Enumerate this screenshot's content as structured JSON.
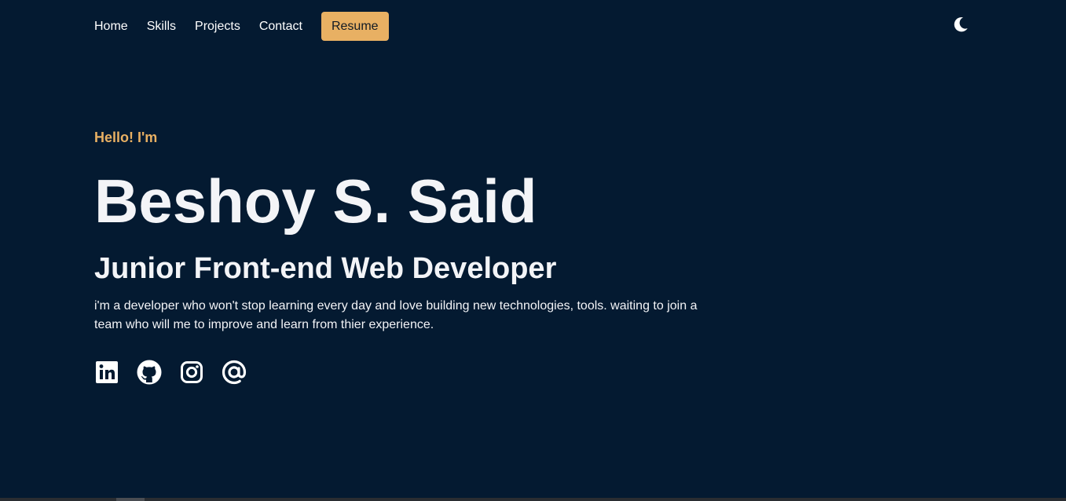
{
  "nav": {
    "links": [
      "Home",
      "Skills",
      "Projects",
      "Contact"
    ],
    "resume_label": "Resume",
    "theme_icon": "moon-icon"
  },
  "hero": {
    "greeting": "Hello! I'm",
    "name": "Beshoy S. Said",
    "role": "Junior Front-end Web Developer",
    "bio": "i'm a developer who won't stop learning every day and love building new technologies, tools. waiting to join a team who will me to improve and learn from thier experience."
  },
  "socials": [
    {
      "icon": "linkedin-icon"
    },
    {
      "icon": "github-icon"
    },
    {
      "icon": "instagram-icon"
    },
    {
      "icon": "email-at-icon"
    }
  ],
  "colors": {
    "background": "#041a31",
    "accent": "#e8b063",
    "text": "#f3f4f7"
  }
}
